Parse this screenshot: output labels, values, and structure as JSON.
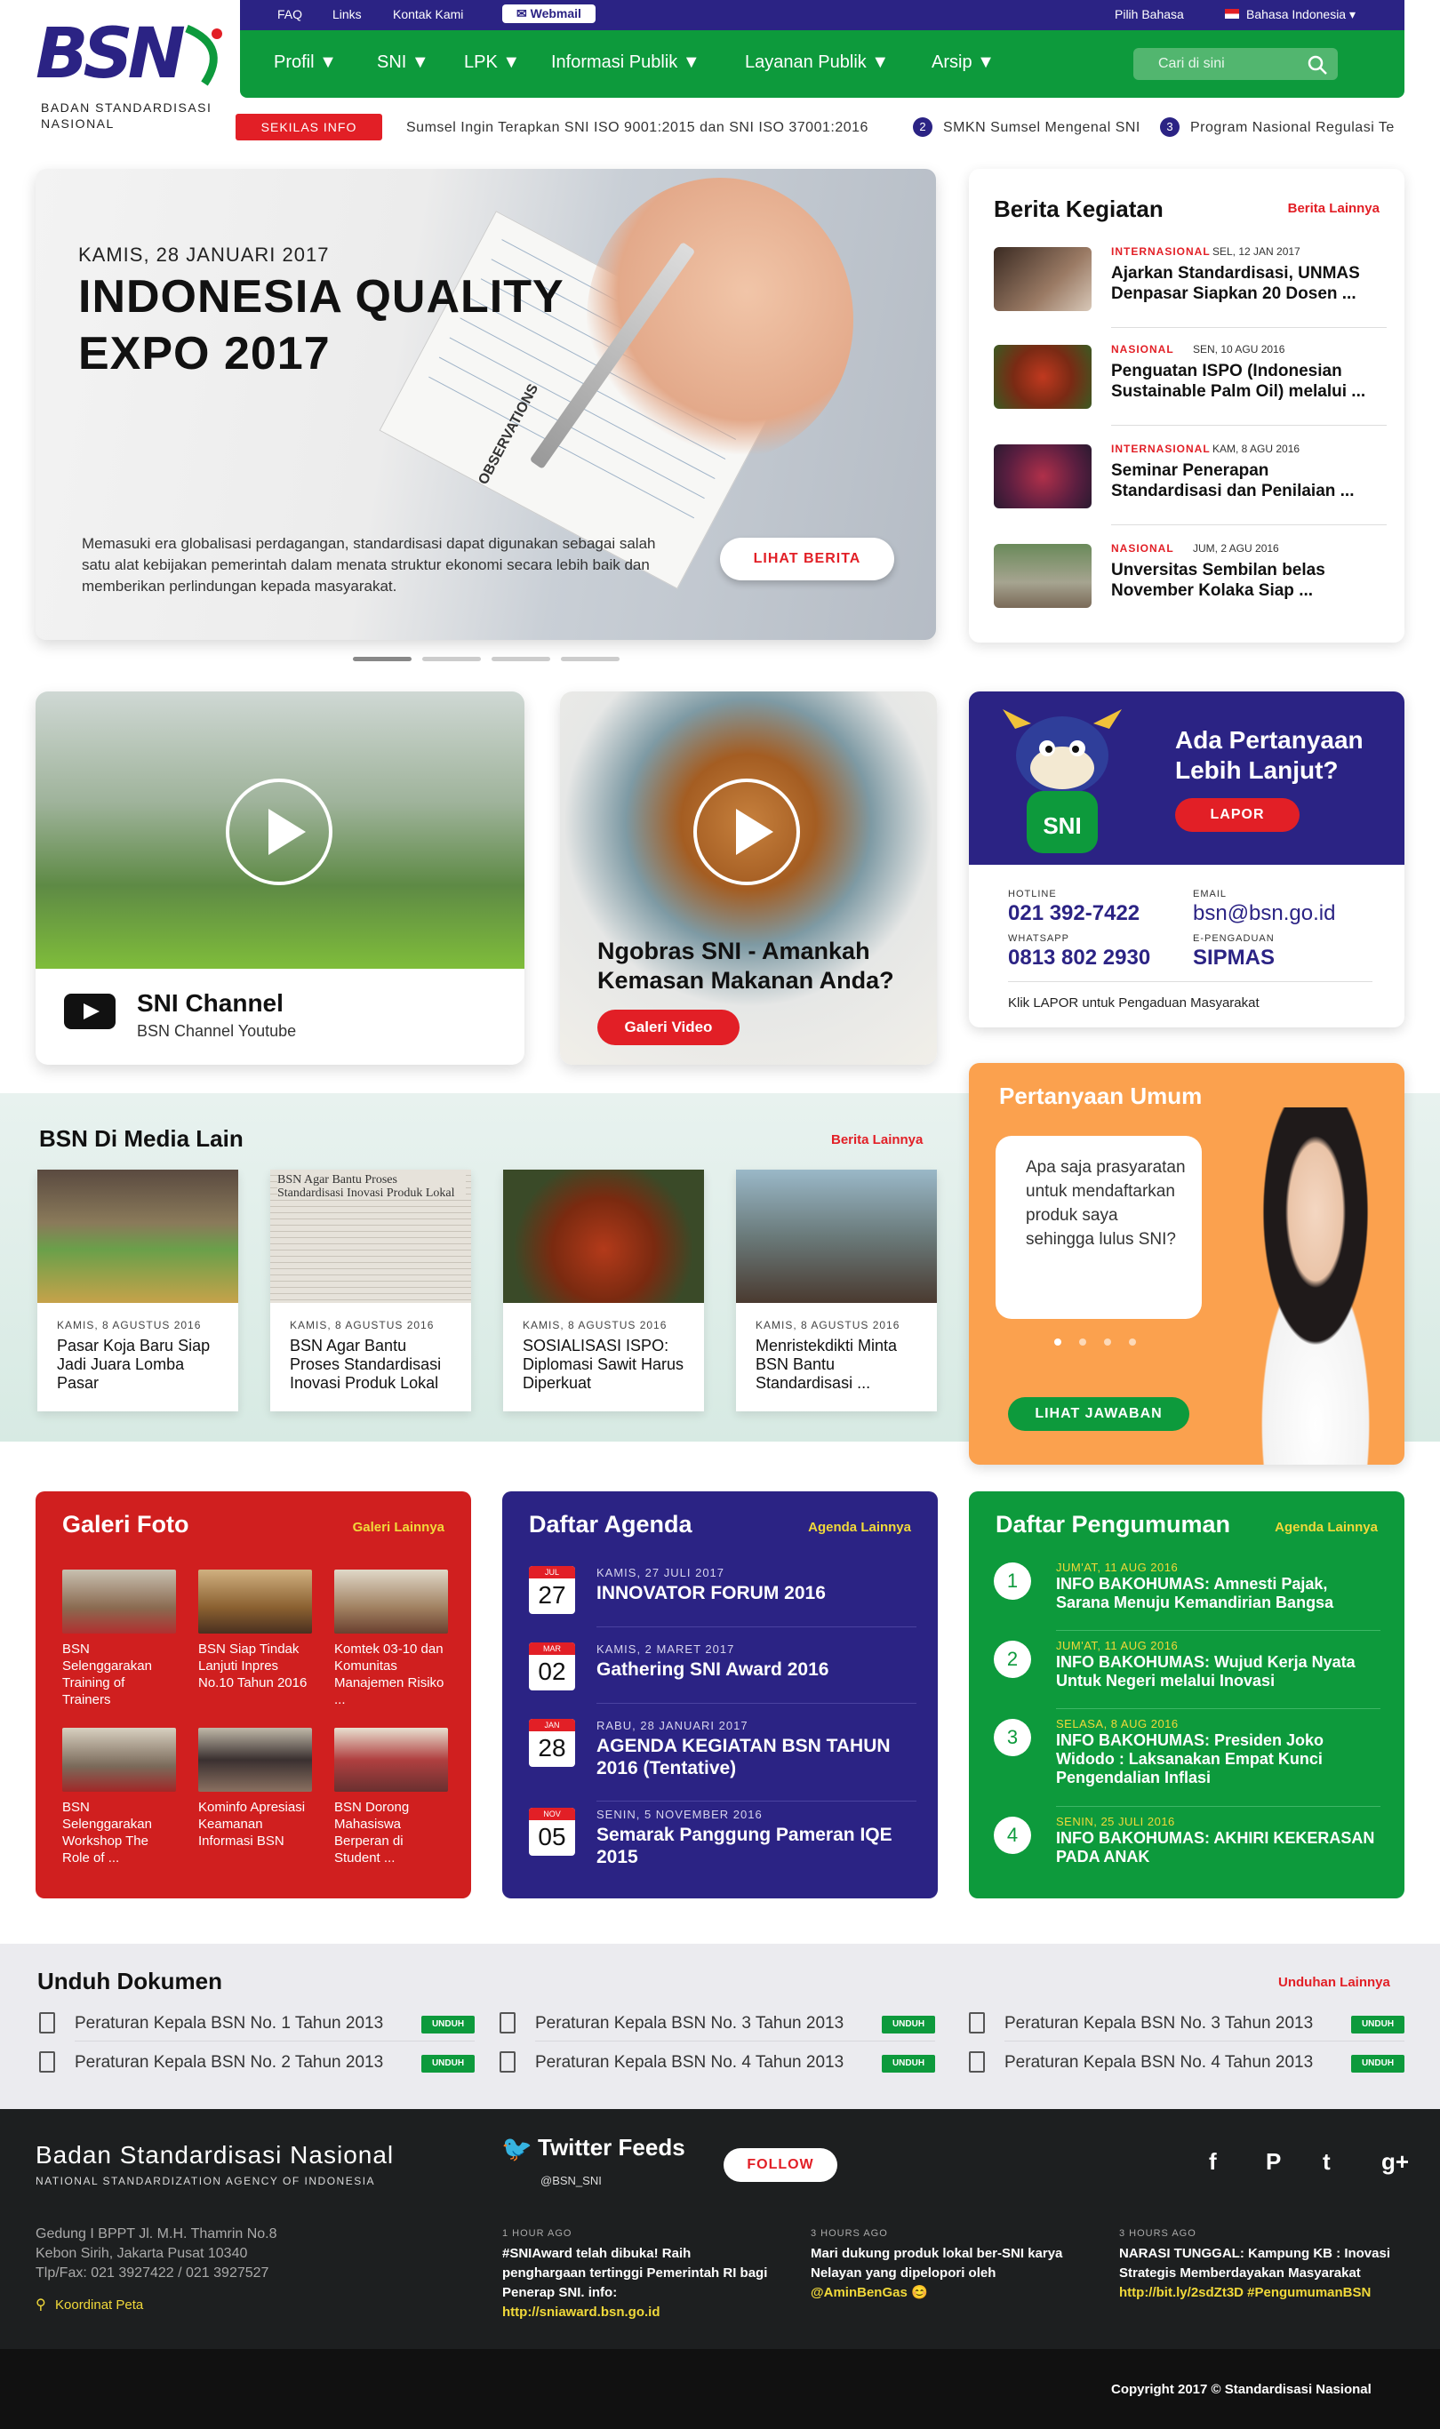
{
  "logo": {
    "mark": "BSN",
    "subtitle": "BADAN STANDARDISASI NASIONAL"
  },
  "topbar": {
    "faq": "FAQ",
    "links": "Links",
    "kontak": "Kontak Kami",
    "webmail": "Webmail",
    "pilih": "Pilih Bahasa",
    "bahasa": "Bahasa Indonesia ▾"
  },
  "nav": {
    "items": [
      "Profil ▼",
      "SNI ▼",
      "LPK ▼",
      "Informasi Publik ▼",
      "Layanan Publik ▼",
      "Arsip ▼"
    ],
    "search_placeholder": "Cari di sini"
  },
  "ticker": {
    "badge": "SEKILAS INFO",
    "items": [
      "Sumsel Ingin Terapkan SNI ISO 9001:2015 dan SNI ISO 37001:2016",
      "SMKN Sumsel Mengenal SNI",
      "Program Nasional Regulasi Te"
    ],
    "nums": [
      "2",
      "3"
    ]
  },
  "hero": {
    "date": "KAMIS, 28 JANUARI 2017",
    "title": "INDONESIA QUALITY EXPO 2017",
    "desc": "Memasuki era globalisasi perdagangan, standardisasi dapat digunakan sebagai salah satu alat kebijakan pemerintah dalam menata struktur ekonomi secara lebih baik dan memberikan perlindungan kepada masyarakat.",
    "button": "LIHAT BERITA",
    "paper_label": "OBSERVATIONS"
  },
  "berita": {
    "title": "Berita Kegiatan",
    "more": "Berita Lainnya",
    "items": [
      {
        "cat": "INTERNASIONAL",
        "date": "SEL, 12 JAN 2017",
        "title": "Ajarkan Standardisasi, UNMAS Denpasar Siapkan 20 Dosen ..."
      },
      {
        "cat": "NASIONAL",
        "date": "SEN, 10 AGU 2016",
        "title": "Penguatan ISPO (Indonesian Sustainable Palm Oil) melalui ..."
      },
      {
        "cat": "INTERNASIONAL",
        "date": "KAM, 8 AGU 2016",
        "title": "Seminar Penerapan Standardisasi dan Penilaian ..."
      },
      {
        "cat": "NASIONAL",
        "date": "JUM, 2 AGU 2016",
        "title": "Unversitas Sembilan belas November Kolaka Siap ..."
      }
    ]
  },
  "video1": {
    "title": "SNI Channel",
    "subtitle": "BSN Channel Youtube"
  },
  "video2": {
    "title": "Ngobras SNI - Amankah Kemasan Makanan Anda?",
    "button": "Galeri Video"
  },
  "contact": {
    "title": "Ada Pertanyaan Lebih Lanjut?",
    "button": "LAPOR",
    "mascot_label": "SNI",
    "hotline_label": "HOTLINE",
    "hotline": "021 392-7422",
    "email_label": "EMAIL",
    "email": "bsn@bsn.go.id",
    "wa_label": "WHATSAPP",
    "wa": "0813 802 2930",
    "ep_label": "E-PENGADUAN",
    "ep": "SIPMAS",
    "note": "Klik LAPOR untuk Pengaduan Masyarakat"
  },
  "media": {
    "title": "BSN Di Media Lain",
    "more": "Berita Lainnya",
    "items": [
      {
        "date": "KAMIS, 8 AGUSTUS 2016",
        "title": "Pasar Koja Baru Siap Jadi Juara Lomba Pasar"
      },
      {
        "date": "KAMIS, 8 AGUSTUS 2016",
        "title": "BSN Agar Bantu Proses Standardisasi Inovasi Produk Lokal"
      },
      {
        "date": "KAMIS, 8 AGUSTUS 2016",
        "title": "SOSIALISASI ISPO: Diplomasi Sawit Harus Diperkuat"
      },
      {
        "date": "KAMIS, 8 AGUSTUS 2016",
        "title": "Menristekdikti Minta BSN Bantu Standardisasi ..."
      }
    ],
    "clip_head": "BSN Agar Bantu Proses Standardisasi Inovasi Produk Lokal"
  },
  "faq": {
    "title": "Pertanyaan Umum",
    "question": "Apa saja prasyaratan untuk mendaftarkan produk saya sehingga lulus SNI?",
    "button": "LIHAT JAWABAN"
  },
  "galeri": {
    "title": "Galeri Foto",
    "more": "Galeri Lainnya",
    "items": [
      "BSN Selenggarakan Training of Trainers",
      "BSN Siap Tindak Lanjuti Inpres No.10 Tahun 2016",
      "Komtek 03-10 dan Komunitas Manajemen Risiko ...",
      "BSN Selenggarakan Workshop The Role of ...",
      "Kominfo Apresiasi Keamanan Informasi BSN",
      "BSN Dorong Mahasiswa Berperan di Student ..."
    ]
  },
  "agenda": {
    "title": "Daftar Agenda",
    "more": "Agenda Lainnya",
    "items": [
      {
        "m": "JUL",
        "d": "27",
        "date": "KAMIS, 27 JULI 2017",
        "title": "INNOVATOR FORUM 2016"
      },
      {
        "m": "MAR",
        "d": "02",
        "date": "KAMIS, 2 MARET 2017",
        "title": "Gathering SNI Award 2016"
      },
      {
        "m": "JAN",
        "d": "28",
        "date": "RABU, 28 JANUARI 2017",
        "title": "AGENDA KEGIATAN BSN TAHUN 2016 (Tentative)"
      },
      {
        "m": "NOV",
        "d": "05",
        "date": "SENIN, 5 NOVEMBER 2016",
        "title": "Semarak Panggung Pameran IQE 2015"
      }
    ]
  },
  "pengumuman": {
    "title": "Daftar Pengumuman",
    "more": "Agenda Lainnya",
    "items": [
      {
        "n": "1",
        "date": "JUM'AT, 11 AUG 2016",
        "title": "INFO BAKOHUMAS: Amnesti Pajak, Sarana Menuju Kemandirian Bangsa"
      },
      {
        "n": "2",
        "date": "JUM'AT, 11 AUG 2016",
        "title": "INFO BAKOHUMAS: Wujud Kerja Nyata Untuk Negeri melalui Inovasi"
      },
      {
        "n": "3",
        "date": "SELASA, 8 AUG 2016",
        "title": "INFO BAKOHUMAS: Presiden Joko Widodo : Laksanakan Empat Kunci Pengendalian Inflasi"
      },
      {
        "n": "4",
        "date": "SENIN, 25 JULI 2016",
        "title": "INFO BAKOHUMAS: AKHIRI KEKERASAN PADA ANAK"
      }
    ]
  },
  "unduh": {
    "title": "Unduh Dokumen",
    "more": "Unduhan Lainnya",
    "btn": "UNDUH",
    "docs": [
      "Peraturan Kepala BSN No. 1 Tahun 2013",
      "Peraturan Kepala BSN No. 3 Tahun 2013",
      "Peraturan Kepala BSN No. 3 Tahun 2013",
      "Peraturan Kepala BSN No. 2 Tahun 2013",
      "Peraturan Kepala BSN No. 4 Tahun 2013",
      "Peraturan Kepala BSN No. 4 Tahun 2013"
    ]
  },
  "footer": {
    "org": "Badan Standardisasi Nasional",
    "org_en": "NATIONAL STANDARDIZATION AGENCY OF INDONESIA",
    "addr1": "Gedung I BPPT Jl. M.H. Thamrin No.8",
    "addr2": "Kebon Sirih, Jakarta Pusat 10340",
    "addr3": "Tlp/Fax: 021 3927422 / 021 3927527",
    "peta": "Koordinat Peta",
    "tw_title": "Twitter Feeds",
    "tw_handle": "@BSN_SNI",
    "follow": "FOLLOW",
    "tweets": [
      {
        "time": "1 HOUR AGO",
        "body": "#SNIAward telah dibuka! Raih penghargaan tertinggi Pemerintah RI bagi Penerap SNI. info: ",
        "link": "http://sniaward.bsn.go.id"
      },
      {
        "time": "3 HOURS AGO",
        "body": "Mari dukung produk lokal ber-SNI karya Nelayan yang dipelopori oleh ",
        "link": "@AminBenGas 😊"
      },
      {
        "time": "3 HOURS AGO",
        "body": "NARASI TUNGGAL: Kampung KB : Inovasi Strategis Memberdayakan Masyarakat ",
        "link": "http://bit.ly/2sdZt3D #PengumumanBSN"
      }
    ],
    "social": [
      "f",
      "P",
      "t",
      "g+"
    ],
    "copyright": "Copyright 2017 © Standardisasi Nasional"
  },
  "colors": {
    "brand": "#2b2384",
    "green": "#0d9a3c",
    "red": "#e21f26",
    "orange": "#fba14e"
  }
}
